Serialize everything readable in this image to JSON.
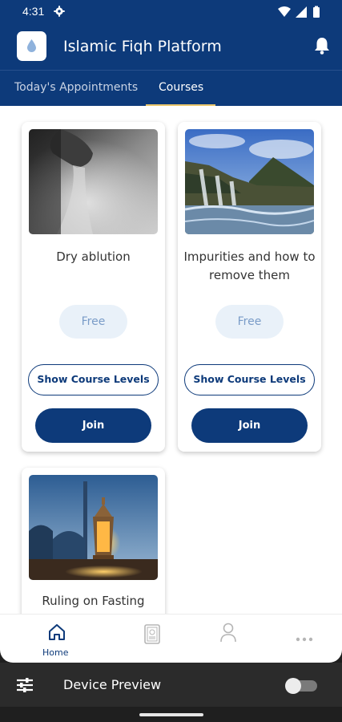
{
  "status_bar": {
    "time": "4:31"
  },
  "app_bar": {
    "title": "Islamic Fiqh Platform"
  },
  "tabs": [
    {
      "label": "Today's Appointments",
      "active": false
    },
    {
      "label": "Courses",
      "active": true
    }
  ],
  "courses": [
    {
      "title": "Dry ablution",
      "price": "Free",
      "levels_label": "Show Course Levels",
      "join_label": "Join",
      "image": "hand-sand-image"
    },
    {
      "title": "Impurities and how to remove them",
      "price": "Free",
      "levels_label": "Show Course Levels",
      "join_label": "Join",
      "image": "waterfall-mountain-image"
    },
    {
      "title": "Ruling on Fasting",
      "image": "lantern-mosque-image"
    }
  ],
  "bottom_nav": [
    {
      "label": "Home",
      "icon": "home-icon",
      "active": true
    },
    {
      "label": "",
      "icon": "quran-book-icon",
      "active": false
    },
    {
      "label": "",
      "icon": "person-icon",
      "active": false
    },
    {
      "label": "",
      "icon": "more-icon",
      "active": false
    }
  ],
  "device_preview": {
    "label": "Device Preview",
    "enabled": false
  },
  "colors": {
    "primary": "#0d3a7a",
    "accent": "#e9c56b",
    "price_bg": "#e9f1f9"
  }
}
